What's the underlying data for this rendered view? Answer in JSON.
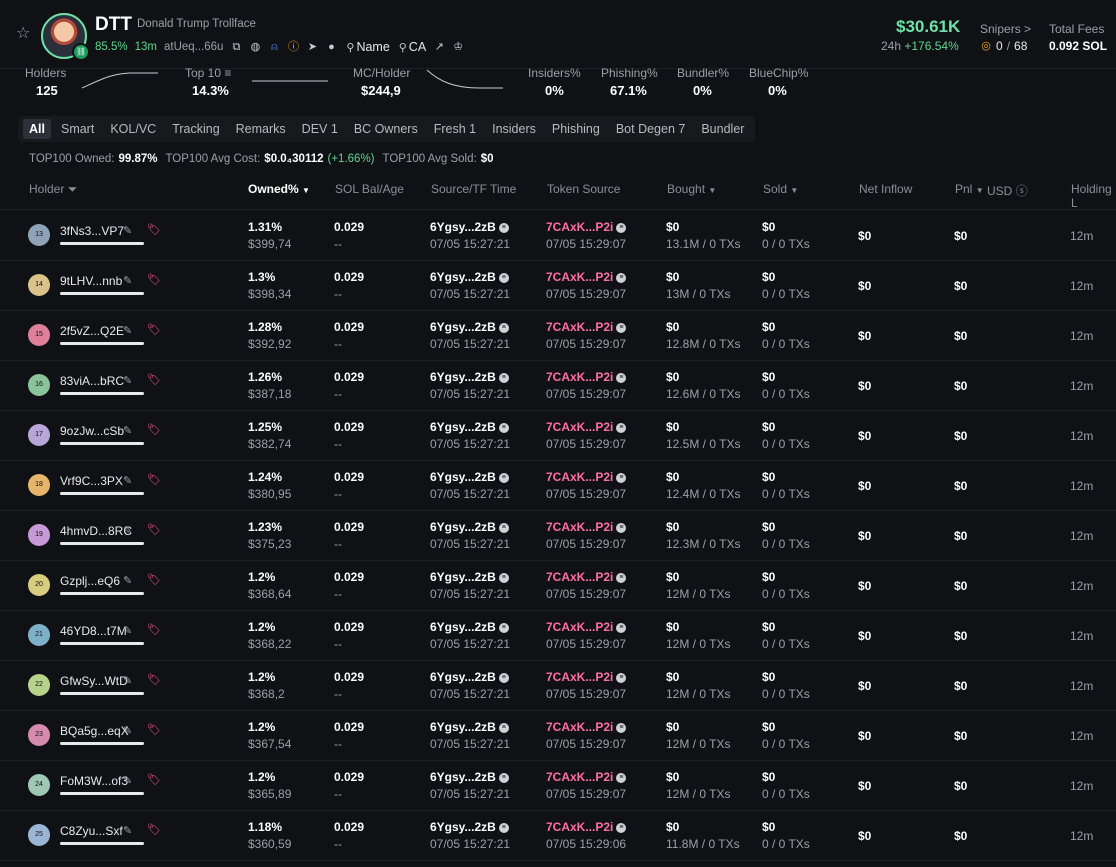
{
  "header": {
    "ticker": "DTT",
    "token_name": "Donald Trump Trollface",
    "pct": "85.5%",
    "age": "13m",
    "ca_short": "atUeq...66u",
    "name_search": "Name",
    "ca_search": "CA",
    "price": "$30.61K",
    "price_period": "24h",
    "price_change": "+176.54%",
    "snipers_label": "Snipers >",
    "snipers_value": "0/68",
    "snipers_value_a": "0",
    "snipers_value_b": "68",
    "fees_label": "Total Fees",
    "fees_value": "0.092 SOL"
  },
  "stats": [
    {
      "label": "Holders",
      "value": "125"
    },
    {
      "label": "Top 10",
      "value": "14.3%"
    },
    {
      "label": "MC/Holder",
      "value": "$244,9"
    },
    {
      "label": "Insiders%",
      "value": "0%"
    },
    {
      "label": "Phishing%",
      "value": "67.1%"
    },
    {
      "label": "Bundler%",
      "value": "0%"
    },
    {
      "label": "BlueChip%",
      "value": "0%"
    }
  ],
  "tabs": [
    "All",
    "Smart",
    "KOL/VC",
    "Tracking",
    "Remarks",
    "DEV 1",
    "BC Owners",
    "Fresh 1",
    "Insiders",
    "Phishing",
    "Bot Degen 7",
    "Bundler"
  ],
  "top100": {
    "owned_label": "TOP100 Owned:",
    "owned_value": "99.87%",
    "cost_label": "TOP100 Avg Cost:",
    "cost_value": "$0.0₄30112",
    "cost_change": "(+1.66%)",
    "sold_label": "TOP100 Avg Sold:",
    "sold_value": "$0"
  },
  "columns": {
    "holder": "Holder",
    "owned": "Owned%",
    "sol_bal": "SOL Bal/Age",
    "source": "Source/TF Time",
    "token_source": "Token Source",
    "bought": "Bought",
    "sold": "Sold",
    "net_inflow": "Net Inflow",
    "pnl": "Pnl",
    "usd": "USD",
    "holding": "Holding L"
  },
  "rows": [
    {
      "rank": "13",
      "addr": "3fNs3...VP7",
      "owned": "1.31%",
      "usd": "$399,74",
      "sol": "0.029",
      "age": "--",
      "src": "6Ygsy...2zB",
      "src_time": "07/05 15:27:21",
      "tsrc": "7CAxK...P2i",
      "tsrc_time": "07/05 15:29:07",
      "bought": "$0",
      "bought_sub": "13.1M / 0 TXs",
      "sold": "$0",
      "sold_sub": "0 / 0 TXs",
      "net": "$0",
      "pnl": "$0",
      "hold": "12m"
    },
    {
      "rank": "14",
      "addr": "9tLHV...nnb",
      "owned": "1.3%",
      "usd": "$398,34",
      "sol": "0.029",
      "age": "--",
      "src": "6Ygsy...2zB",
      "src_time": "07/05 15:27:21",
      "tsrc": "7CAxK...P2i",
      "tsrc_time": "07/05 15:29:07",
      "bought": "$0",
      "bought_sub": "13M / 0 TXs",
      "sold": "$0",
      "sold_sub": "0 / 0 TXs",
      "net": "$0",
      "pnl": "$0",
      "hold": "12m"
    },
    {
      "rank": "15",
      "addr": "2f5vZ...Q2E",
      "owned": "1.28%",
      "usd": "$392,92",
      "sol": "0.029",
      "age": "--",
      "src": "6Ygsy...2zB",
      "src_time": "07/05 15:27:21",
      "tsrc": "7CAxK...P2i",
      "tsrc_time": "07/05 15:29:07",
      "bought": "$0",
      "bought_sub": "12.8M / 0 TXs",
      "sold": "$0",
      "sold_sub": "0 / 0 TXs",
      "net": "$0",
      "pnl": "$0",
      "hold": "12m"
    },
    {
      "rank": "16",
      "addr": "83viA...bRC",
      "owned": "1.26%",
      "usd": "$387,18",
      "sol": "0.029",
      "age": "--",
      "src": "6Ygsy...2zB",
      "src_time": "07/05 15:27:21",
      "tsrc": "7CAxK...P2i",
      "tsrc_time": "07/05 15:29:07",
      "bought": "$0",
      "bought_sub": "12.6M / 0 TXs",
      "sold": "$0",
      "sold_sub": "0 / 0 TXs",
      "net": "$0",
      "pnl": "$0",
      "hold": "12m"
    },
    {
      "rank": "17",
      "addr": "9ozJw...cSb",
      "owned": "1.25%",
      "usd": "$382,74",
      "sol": "0.029",
      "age": "--",
      "src": "6Ygsy...2zB",
      "src_time": "07/05 15:27:21",
      "tsrc": "7CAxK...P2i",
      "tsrc_time": "07/05 15:29:07",
      "bought": "$0",
      "bought_sub": "12.5M / 0 TXs",
      "sold": "$0",
      "sold_sub": "0 / 0 TXs",
      "net": "$0",
      "pnl": "$0",
      "hold": "12m"
    },
    {
      "rank": "18",
      "addr": "Vrf9C...3PX",
      "owned": "1.24%",
      "usd": "$380,95",
      "sol": "0.029",
      "age": "--",
      "src": "6Ygsy...2zB",
      "src_time": "07/05 15:27:21",
      "tsrc": "7CAxK...P2i",
      "tsrc_time": "07/05 15:29:07",
      "bought": "$0",
      "bought_sub": "12.4M / 0 TXs",
      "sold": "$0",
      "sold_sub": "0 / 0 TXs",
      "net": "$0",
      "pnl": "$0",
      "hold": "12m"
    },
    {
      "rank": "19",
      "addr": "4hmvD...8RC",
      "owned": "1.23%",
      "usd": "$375,23",
      "sol": "0.029",
      "age": "--",
      "src": "6Ygsy...2zB",
      "src_time": "07/05 15:27:21",
      "tsrc": "7CAxK...P2i",
      "tsrc_time": "07/05 15:29:07",
      "bought": "$0",
      "bought_sub": "12.3M / 0 TXs",
      "sold": "$0",
      "sold_sub": "0 / 0 TXs",
      "net": "$0",
      "pnl": "$0",
      "hold": "12m"
    },
    {
      "rank": "20",
      "addr": "Gzplj...eQ6",
      "owned": "1.2%",
      "usd": "$368,64",
      "sol": "0.029",
      "age": "--",
      "src": "6Ygsy...2zB",
      "src_time": "07/05 15:27:21",
      "tsrc": "7CAxK...P2i",
      "tsrc_time": "07/05 15:29:07",
      "bought": "$0",
      "bought_sub": "12M / 0 TXs",
      "sold": "$0",
      "sold_sub": "0 / 0 TXs",
      "net": "$0",
      "pnl": "$0",
      "hold": "12m"
    },
    {
      "rank": "21",
      "addr": "46YD8...t7M",
      "owned": "1.2%",
      "usd": "$368,22",
      "sol": "0.029",
      "age": "--",
      "src": "6Ygsy...2zB",
      "src_time": "07/05 15:27:21",
      "tsrc": "7CAxK...P2i",
      "tsrc_time": "07/05 15:29:07",
      "bought": "$0",
      "bought_sub": "12M / 0 TXs",
      "sold": "$0",
      "sold_sub": "0 / 0 TXs",
      "net": "$0",
      "pnl": "$0",
      "hold": "12m"
    },
    {
      "rank": "22",
      "addr": "GfwSy...WtD",
      "owned": "1.2%",
      "usd": "$368,2",
      "sol": "0.029",
      "age": "--",
      "src": "6Ygsy...2zB",
      "src_time": "07/05 15:27:21",
      "tsrc": "7CAxK...P2i",
      "tsrc_time": "07/05 15:29:07",
      "bought": "$0",
      "bought_sub": "12M / 0 TXs",
      "sold": "$0",
      "sold_sub": "0 / 0 TXs",
      "net": "$0",
      "pnl": "$0",
      "hold": "12m"
    },
    {
      "rank": "23",
      "addr": "BQa5g...eqX",
      "owned": "1.2%",
      "usd": "$367,54",
      "sol": "0.029",
      "age": "--",
      "src": "6Ygsy...2zB",
      "src_time": "07/05 15:27:21",
      "tsrc": "7CAxK...P2i",
      "tsrc_time": "07/05 15:29:07",
      "bought": "$0",
      "bought_sub": "12M / 0 TXs",
      "sold": "$0",
      "sold_sub": "0 / 0 TXs",
      "net": "$0",
      "pnl": "$0",
      "hold": "12m"
    },
    {
      "rank": "24",
      "addr": "FoM3W...of3",
      "owned": "1.2%",
      "usd": "$365,89",
      "sol": "0.029",
      "age": "--",
      "src": "6Ygsy...2zB",
      "src_time": "07/05 15:27:21",
      "tsrc": "7CAxK...P2i",
      "tsrc_time": "07/05 15:29:07",
      "bought": "$0",
      "bought_sub": "12M / 0 TXs",
      "sold": "$0",
      "sold_sub": "0 / 0 TXs",
      "net": "$0",
      "pnl": "$0",
      "hold": "12m"
    },
    {
      "rank": "25",
      "addr": "C8Zyu...Sxf",
      "owned": "1.18%",
      "usd": "$360,59",
      "sol": "0.029",
      "age": "--",
      "src": "6Ygsy...2zB",
      "src_time": "07/05 15:27:21",
      "tsrc": "7CAxK...P2i",
      "tsrc_time": "07/05 15:29:06",
      "bought": "$0",
      "bought_sub": "11.8M / 0 TXs",
      "sold": "$0",
      "sold_sub": "0 / 0 TXs",
      "net": "$0",
      "pnl": "$0",
      "hold": "12m"
    }
  ],
  "colors": {
    "accent_green": "#5fd78e",
    "price_green": "#6fe0a6",
    "danger": "#f2555a",
    "token_source_pink": "#ff6fa3"
  },
  "icons": [
    "star-icon",
    "copy-icon",
    "globe-icon",
    "user-icon",
    "warning-icon",
    "telegram-icon",
    "twitter-icon",
    "search-icon",
    "external-link-icon",
    "crown-icon",
    "filter-icon",
    "pencil-icon",
    "tag-icon",
    "sol-icon"
  ]
}
